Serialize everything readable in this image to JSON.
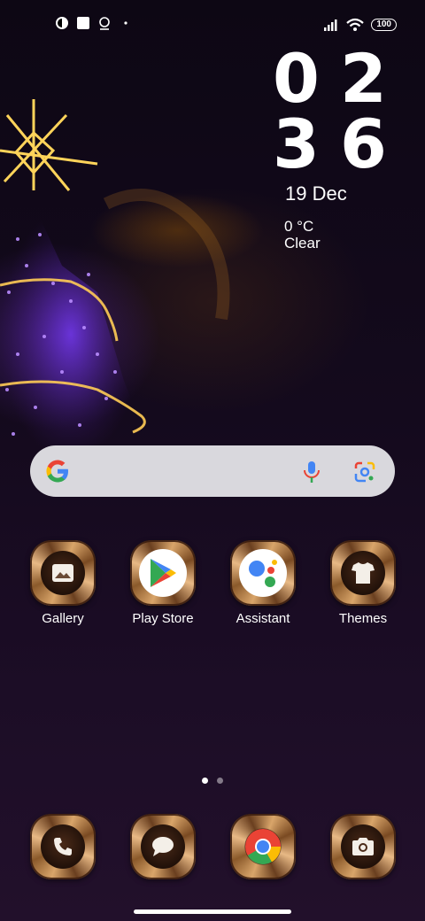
{
  "status_bar": {
    "battery": "100",
    "icons_left": [
      "notification-icon",
      "square-icon",
      "location-icon",
      "dot-icon"
    ],
    "icons_right": [
      "signal-icon",
      "wifi-icon",
      "battery-icon"
    ]
  },
  "clock": {
    "hour_tens": "0",
    "hour_ones": "2",
    "min_tens": "3",
    "min_ones": "6",
    "date": "19 Dec",
    "temperature": "0 °C",
    "condition": "Clear"
  },
  "search": {
    "icons": [
      "google-g-icon",
      "microphone-icon",
      "google-lens-icon"
    ]
  },
  "apps": [
    {
      "label": "Gallery",
      "icon": "gallery-icon"
    },
    {
      "label": "Play Store",
      "icon": "play-store-icon"
    },
    {
      "label": "Assistant",
      "icon": "assistant-icon"
    },
    {
      "label": "Themes",
      "icon": "themes-icon"
    }
  ],
  "dock": [
    {
      "icon": "phone-icon"
    },
    {
      "icon": "messages-icon"
    },
    {
      "icon": "chrome-icon"
    },
    {
      "icon": "camera-icon"
    }
  ],
  "page_indicator": {
    "pages": 2,
    "current": 1
  },
  "colors": {
    "accent_gold": "#d9a56a",
    "search_bg": "#e8e8ec",
    "google_blue": "#4285F4",
    "google_red": "#EA4335",
    "google_yellow": "#FBBC05",
    "google_green": "#34A853"
  }
}
